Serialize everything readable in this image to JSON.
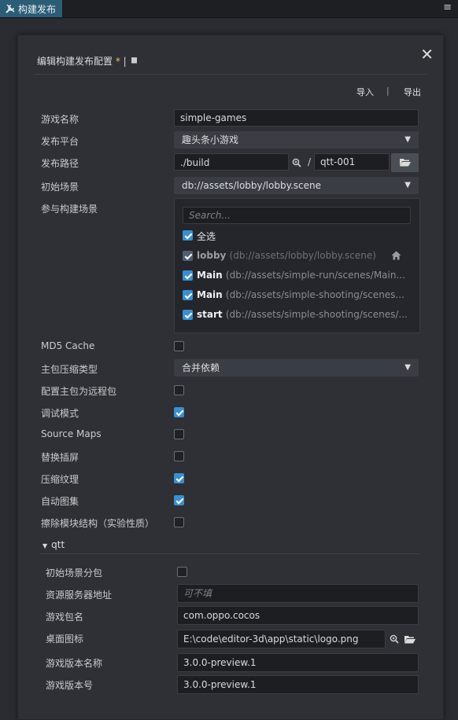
{
  "tab": {
    "title": "构建发布"
  },
  "dialog": {
    "title": "编辑构建发布配置",
    "modified_mark": "*",
    "separator": "|",
    "import_label": "导入",
    "ie_separator": "|",
    "export_label": "导出"
  },
  "fields": {
    "game_name": {
      "label": "游戏名称",
      "value": "simple-games"
    },
    "platform": {
      "label": "发布平台",
      "value": "趣头条小游戏"
    },
    "build_path": {
      "label": "发布路径",
      "value": "./build",
      "separator": "/",
      "name_value": "qtt-001"
    },
    "start_scene": {
      "label": "初始场景",
      "value": "db://assets/lobby/lobby.scene"
    },
    "scenes": {
      "label": "参与构建场景",
      "search_placeholder": "Search...",
      "select_all": "全选",
      "items": [
        {
          "name": "lobby",
          "path": "(db://assets/lobby/lobby.scene)",
          "checked": true,
          "disabled": true,
          "home": true
        },
        {
          "name": "Main",
          "path": "(db://assets/simple-run/scenes/Main...",
          "checked": true
        },
        {
          "name": "Main",
          "path": "(db://assets/simple-shooting/scenes...",
          "checked": true
        },
        {
          "name": "start",
          "path": "(db://assets/simple-shooting/scenes/...",
          "checked": true
        }
      ]
    },
    "md5_cache": {
      "label": "MD5 Cache",
      "checked": false
    },
    "compression_type": {
      "label": "主包压缩类型",
      "value": "合并依赖"
    },
    "main_remote": {
      "label": "配置主包为远程包",
      "checked": false
    },
    "debug": {
      "label": "调试模式",
      "checked": true
    },
    "source_maps": {
      "label": "Source Maps",
      "checked": false
    },
    "splash": {
      "label": "替换插屏",
      "checked": false
    },
    "compress_texture": {
      "label": "压缩纹理",
      "checked": true
    },
    "auto_atlas": {
      "label": "自动图集",
      "checked": true
    },
    "erase_modules": {
      "label": "擦除模块结构（实验性质）",
      "checked": false
    }
  },
  "qtt": {
    "section_title": "qtt",
    "start_scene_subpackage": {
      "label": "初始场景分包",
      "checked": false
    },
    "server_address": {
      "label": "资源服务器地址",
      "placeholder": "可不填"
    },
    "package_name": {
      "label": "游戏包名",
      "value": "com.oppo.cocos"
    },
    "desktop_icon": {
      "label": "桌面图标",
      "value": "E:\\code\\editor-3d\\app\\static\\logo.png"
    },
    "version_name": {
      "label": "游戏版本名称",
      "value": "3.0.0-preview.1"
    },
    "version_code": {
      "label": "游戏版本号",
      "value": "3.0.0-preview.1"
    }
  }
}
